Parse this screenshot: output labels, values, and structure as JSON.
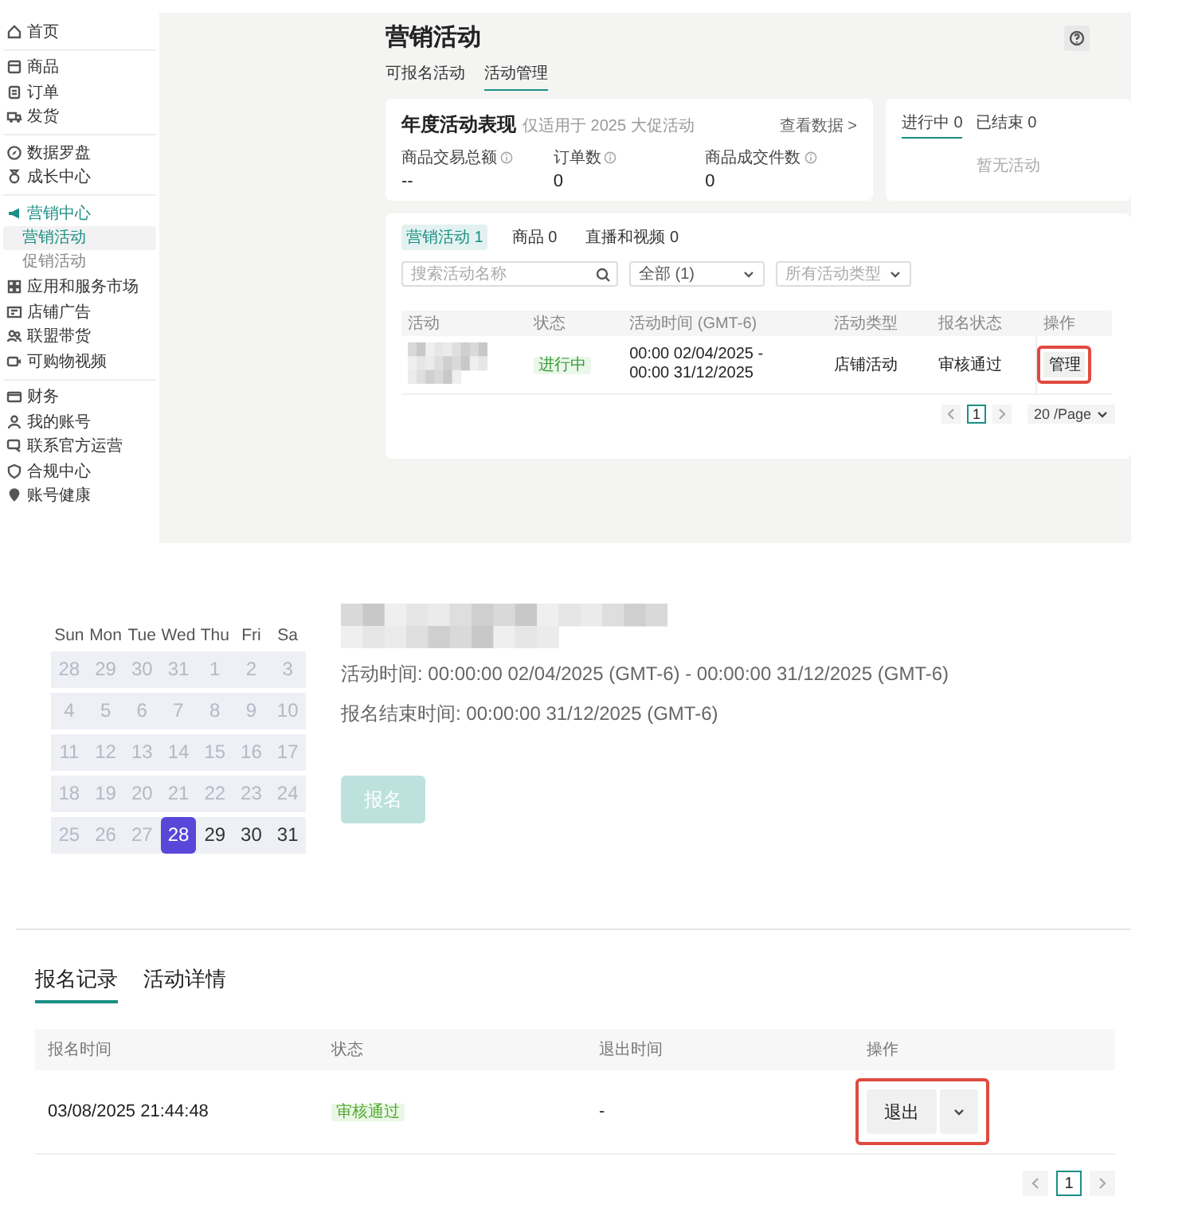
{
  "sidebar": {
    "sections": [
      {
        "items": [
          {
            "label": "首页",
            "selected": false
          }
        ]
      },
      {
        "items": [
          {
            "label": "商品",
            "selected": false
          },
          {
            "label": "订单",
            "selected": false
          },
          {
            "label": "发货",
            "selected": false
          }
        ]
      },
      {
        "items": [
          {
            "label": "数据罗盘",
            "selected": false
          },
          {
            "label": "成长中心",
            "selected": false
          }
        ]
      },
      {
        "items": [
          {
            "label": "营销中心",
            "selected": false,
            "children": [
              {
                "label": "营销活动",
                "selected": true
              },
              {
                "label": "促销活动",
                "selected": false
              }
            ]
          },
          {
            "label": "应用和服务市场",
            "selected": false
          },
          {
            "label": "店铺广告",
            "selected": false
          },
          {
            "label": "联盟带货",
            "selected": false
          },
          {
            "label": "可购物视频",
            "selected": false
          }
        ]
      },
      {
        "items": [
          {
            "label": "财务",
            "selected": false
          },
          {
            "label": "我的账号",
            "selected": false
          },
          {
            "label": "联系官方运营",
            "selected": false
          },
          {
            "label": "合规中心",
            "selected": false
          },
          {
            "label": "账号健康",
            "selected": false
          }
        ]
      }
    ]
  },
  "page": {
    "title": "营销活动",
    "tabs": [
      {
        "label": "可报名活动",
        "selected": false
      },
      {
        "label": "活动管理",
        "selected": true
      }
    ],
    "summary": {
      "title": "年度活动表现",
      "subtitle": "仅适用于 2025 大促活动",
      "link": "查看数据 >",
      "metrics": [
        {
          "label": "商品交易总额",
          "value": "--"
        },
        {
          "label": "订单数",
          "value": "0"
        },
        {
          "label": "商品成交件数",
          "value": "0"
        }
      ]
    },
    "status_card": {
      "tabs": [
        {
          "label": "进行中",
          "count": "0",
          "selected": true
        },
        {
          "label": "已结束",
          "count": "0",
          "selected": false
        }
      ],
      "empty": "暂无活动"
    },
    "list": {
      "tabs": [
        {
          "label": "营销活动",
          "count": "1",
          "selected": true
        },
        {
          "label": "商品",
          "count": "0",
          "selected": false
        },
        {
          "label": "直播和视频",
          "count": "0",
          "selected": false
        }
      ],
      "search": {
        "placeholder": "搜索活动名称"
      },
      "filter": {
        "value": "全部",
        "count": "(1)"
      },
      "type_filter": {
        "placeholder": "所有活动类型"
      },
      "columns": [
        "活动",
        "状态",
        "活动时间 (GMT-6)",
        "活动类型",
        "报名状态",
        "操作"
      ],
      "rows": [
        {
          "status": "进行中",
          "time": "00:00 02/04/2025 - 00:00 31/12/2025",
          "type": "店铺活动",
          "signup": "审核通过",
          "action": "管理",
          "highlighted": true
        }
      ],
      "pagination": {
        "pages": [
          {
            "label": "1",
            "selected": true
          }
        ],
        "page_size": "20 /Page"
      }
    }
  },
  "calendar": {
    "weekdays": [
      "Sun",
      "Mon",
      "Tue",
      "Wed",
      "Thu",
      "Fri",
      "Sa"
    ],
    "weeks": [
      [
        {
          "day": "28",
          "muted": true,
          "selected": false
        },
        {
          "day": "29",
          "muted": true,
          "selected": false
        },
        {
          "day": "30",
          "muted": true,
          "selected": false
        },
        {
          "day": "31",
          "muted": true,
          "selected": false
        },
        {
          "day": "1",
          "muted": true,
          "selected": false
        },
        {
          "day": "2",
          "muted": true,
          "selected": false
        },
        {
          "day": "3",
          "muted": true,
          "selected": false
        }
      ],
      [
        {
          "day": "4",
          "muted": true,
          "selected": false
        },
        {
          "day": "5",
          "muted": true,
          "selected": false
        },
        {
          "day": "6",
          "muted": true,
          "selected": false
        },
        {
          "day": "7",
          "muted": true,
          "selected": false
        },
        {
          "day": "8",
          "muted": true,
          "selected": false
        },
        {
          "day": "9",
          "muted": true,
          "selected": false
        },
        {
          "day": "10",
          "muted": true,
          "selected": false
        }
      ],
      [
        {
          "day": "11",
          "muted": true,
          "selected": false
        },
        {
          "day": "12",
          "muted": true,
          "selected": false
        },
        {
          "day": "13",
          "muted": true,
          "selected": false
        },
        {
          "day": "14",
          "muted": true,
          "selected": false
        },
        {
          "day": "15",
          "muted": true,
          "selected": false
        },
        {
          "day": "16",
          "muted": true,
          "selected": false
        },
        {
          "day": "17",
          "muted": true,
          "selected": false
        }
      ],
      [
        {
          "day": "18",
          "muted": true,
          "selected": false
        },
        {
          "day": "19",
          "muted": true,
          "selected": false
        },
        {
          "day": "20",
          "muted": true,
          "selected": false
        },
        {
          "day": "21",
          "muted": true,
          "selected": false
        },
        {
          "day": "22",
          "muted": true,
          "selected": false
        },
        {
          "day": "23",
          "muted": true,
          "selected": false
        },
        {
          "day": "24",
          "muted": true,
          "selected": false
        }
      ],
      [
        {
          "day": "25",
          "muted": true,
          "selected": false
        },
        {
          "day": "26",
          "muted": true,
          "selected": false
        },
        {
          "day": "27",
          "muted": true,
          "selected": false
        },
        {
          "day": "28",
          "muted": false,
          "selected": true
        },
        {
          "day": "29",
          "muted": false,
          "selected": false
        },
        {
          "day": "30",
          "muted": false,
          "selected": false
        },
        {
          "day": "31",
          "muted": false,
          "selected": false
        }
      ]
    ]
  },
  "detail": {
    "lines": [
      "活动时间: 00:00:00 02/04/2025 (GMT-6) - 00:00:00 31/12/2025 (GMT-6)",
      "报名结束时间: 00:00:00 31/12/2025 (GMT-6)"
    ],
    "button": {
      "label": "报名",
      "disabled": true
    }
  },
  "records": {
    "tabs": [
      {
        "label": "报名记录",
        "selected": true
      },
      {
        "label": "活动详情",
        "selected": false
      }
    ],
    "columns": [
      "报名时间",
      "状态",
      "退出时间",
      "操作"
    ],
    "rows": [
      {
        "time": "03/08/2025 21:44:48",
        "status": "审核通过",
        "exit_time": "-",
        "action": "退出",
        "highlighted": true
      }
    ],
    "pagination": {
      "pages": [
        {
          "label": "1",
          "selected": true
        }
      ]
    }
  }
}
